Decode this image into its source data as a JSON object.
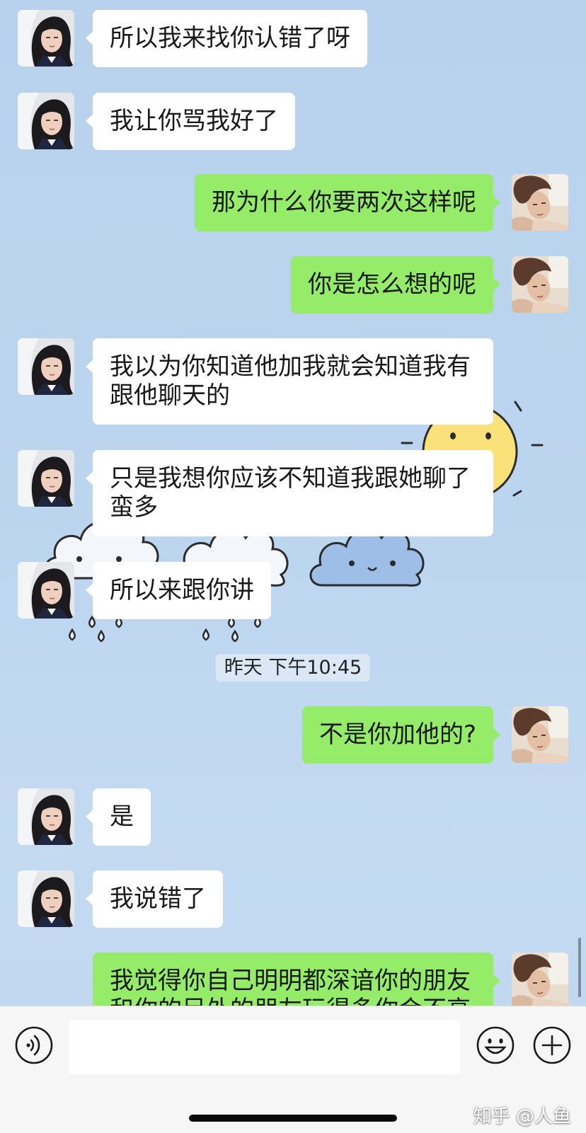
{
  "chat": {
    "messages": [
      {
        "outgoing": false,
        "text": "所以我来找你认错了呀"
      },
      {
        "outgoing": false,
        "text": "我让你骂我好了"
      },
      {
        "outgoing": true,
        "text": "那为什么你要两次这样呢"
      },
      {
        "outgoing": true,
        "text": "你是怎么想的呢"
      },
      {
        "outgoing": false,
        "text": "我以为你知道他加我就会知道我有跟他聊天的"
      },
      {
        "outgoing": false,
        "text": "只是我想你应该不知道我跟她聊了蛮多"
      },
      {
        "outgoing": false,
        "text": "所以来跟你讲"
      },
      {
        "outgoing": true,
        "text": "不是你加他的?"
      },
      {
        "outgoing": false,
        "text": "是"
      },
      {
        "outgoing": false,
        "text": "我说错了"
      },
      {
        "outgoing": true,
        "text": "我觉得你自己明明都深谙你的朋友和你的另外的朋友玩得多你会不高"
      }
    ],
    "timestamp": "昨天 下午10:45"
  },
  "input_bar": {
    "value": "",
    "icons": {
      "voice": "voice-icon",
      "emoji": "emoji-icon",
      "more": "plus-icon"
    }
  },
  "watermark": "知乎 @人鱼",
  "wallpaper_icons": [
    "sun-icon",
    "cloud-icon",
    "raindrop-icon"
  ],
  "colors": {
    "chat_background": "#bcd5ef",
    "incoming_bubble": "#ffffff",
    "outgoing_bubble": "#95ec69",
    "input_bar": "#f6f6f6"
  }
}
